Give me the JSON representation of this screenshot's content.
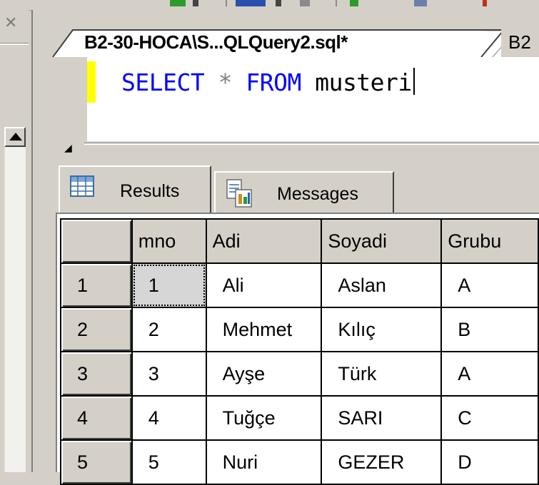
{
  "editor": {
    "tab_active_label": "B2-30-HOCA\\S...QLQuery2.sql*",
    "tab_second_label": "B2",
    "query_kw1": "SELECT",
    "query_op": "*",
    "query_kw2": "FROM",
    "query_table": "musteri"
  },
  "results": {
    "tabs": [
      {
        "label": "Results",
        "icon": "grid-icon"
      },
      {
        "label": "Messages",
        "icon": "messages-icon"
      }
    ],
    "columns": [
      "mno",
      "Adi",
      "Soyadi",
      "Grubu"
    ],
    "rows": [
      {
        "num": "1",
        "mno": "1",
        "adi": "Ali",
        "soyadi": "Aslan",
        "grubu": "A"
      },
      {
        "num": "2",
        "mno": "2",
        "adi": "Mehmet",
        "soyadi": "Kılıç",
        "grubu": "B"
      },
      {
        "num": "3",
        "mno": "3",
        "adi": "Ayşe",
        "soyadi": "Türk",
        "grubu": "A"
      },
      {
        "num": "4",
        "mno": "4",
        "adi": "Tuğçe",
        "soyadi": "SARI",
        "grubu": "C"
      },
      {
        "num": "5",
        "mno": "5",
        "adi": "Nuri",
        "soyadi": "GEZER",
        "grubu": "D"
      }
    ]
  },
  "left_panel": {
    "close_glyph": "✕",
    "scroll_up": "up-arrow-icon"
  },
  "colors": {
    "chrome": "#d4d0c8",
    "keyword": "#0000ff",
    "operator": "#808080",
    "modified_marker": "#ffff00"
  }
}
